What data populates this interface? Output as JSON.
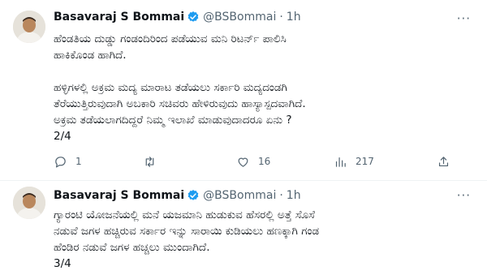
{
  "tweets": [
    {
      "author": "Basavaraj S Bommai",
      "handle": "@BSBommai",
      "separator": "·",
      "time": "1h",
      "more": "···",
      "lines": [
        "ಹೆಂಡತಿಯ ದುಡ್ಡು ಗಂಡಂದಿರಿಂದ ಪಡೆಯುವ ಮನಿ ರಿಟರ್ನ್ ಪಾಲಿಸಿ",
        "ಹಾಕಿಕೊಂಡ ಹಾಗಿದೆ.",
        "",
        "ಹಳ್ಳಿಗಳಲ್ಲಿ ಅಕ್ರಮ ಮದ್ಯ ಮಾರಾಟ ತಡೆಯಲು ಸರ್ಕಾರಿ ಮದ್ಯದಂಡಗಿ",
        "ತೆರೆಯುತ್ತಿರುವುದಾಗಿ ಅಬಕಾರಿ ಸಚಿವರು ಹೇಳಿರುವುದು ಹಾಸ್ಯಾಸ್ಪದವಾಗಿದೆ.",
        "ಅಕ್ರಮ ತಡೆಯಲಾಗದಿದ್ದರೆ ನಿಮ್ಮ ಇಲಾಖೆ ಮಾಡುವುದಾದರೂ ಏನು ?",
        "2/4"
      ],
      "actions": {
        "replies": "1",
        "retweets": "",
        "likes": "16",
        "views": "217"
      }
    },
    {
      "author": "Basavaraj S Bommai",
      "handle": "@BSBommai",
      "separator": "·",
      "time": "1h",
      "more": "···",
      "lines": [
        "ಗ್ಯಾರಂಟಿ ಯೋಜನೆಯಲ್ಲಿ ಮನೆ ಯಜಮಾನಿ ಹುಡುಕುವ ಹೆಸರಲ್ಲಿ ಅತ್ತೆ ಸೊಸೆ",
        "ನಡುವೆ ಜಗಳ ಹಚ್ಚಿರುವ ಸರ್ಕಾರ ಇನ್ನು ಸಾರಾಯಿ ಕುಡಿಯಲು ಹಣಕ್ಕಾಗಿ ಗಂಡ",
        "ಹೆಂಡಿರ ನಡುವೆ ಜಗಳ ಹಚ್ಚಲು ಮುಂದಾಗಿದೆ.",
        "3/4"
      ]
    }
  ],
  "colors": {
    "text": "#0f1419",
    "secondary": "#536471",
    "verified": "#1d9bf0",
    "divider": "#eff3f4"
  },
  "icons": [
    "reply-icon",
    "retweet-icon",
    "like-icon",
    "views-icon",
    "share-icon",
    "verified-badge-icon",
    "more-icon"
  ]
}
